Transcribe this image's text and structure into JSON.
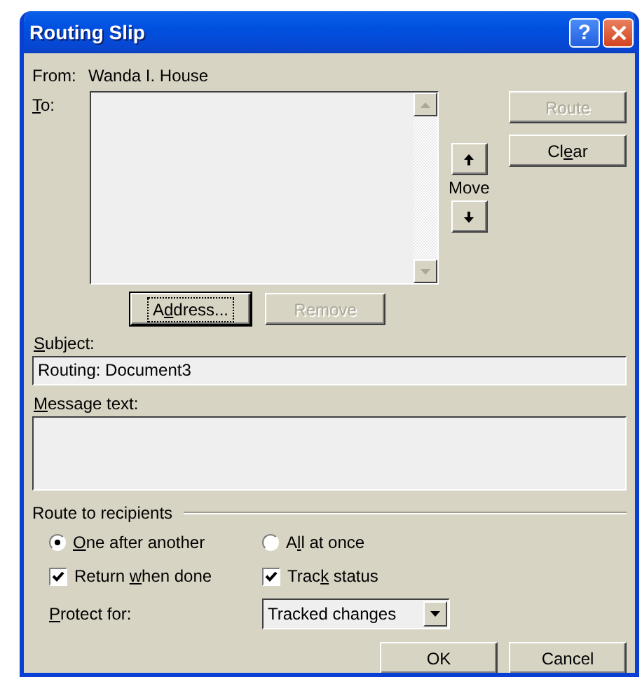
{
  "window": {
    "title": "Routing Slip",
    "help": "?"
  },
  "from": {
    "label": "From:",
    "value": "Wanda I. House"
  },
  "to": {
    "label": {
      "key": "T",
      "post": "o:"
    }
  },
  "move": {
    "label": "Move"
  },
  "side_buttons": [
    {
      "label": {
        "pre": "Route"
      },
      "disabled": true
    },
    {
      "label": {
        "pre": "Cl",
        "key": "e",
        "post": "ar"
      },
      "disabled": false
    }
  ],
  "list_buttons": [
    {
      "label": {
        "pre": "A",
        "key": "d",
        "post": "dress..."
      },
      "disabled": false,
      "default": true
    },
    {
      "label": {
        "pre": "Remove"
      },
      "disabled": true,
      "default": false
    }
  ],
  "subject": {
    "label": {
      "key": "S",
      "post": "ubject:"
    },
    "value": "Routing: Document3"
  },
  "message": {
    "label": {
      "key": "M",
      "post": "essage text:"
    }
  },
  "route_group": {
    "title": "Route to recipients",
    "options": [
      {
        "label": {
          "key": "O",
          "post": "ne after another"
        },
        "selected": true
      },
      {
        "label": {
          "pre": "A",
          "key": "l",
          "post": "l at once"
        },
        "selected": false
      }
    ],
    "checks": [
      {
        "label": {
          "pre": "Return ",
          "key": "w",
          "post": "hen done"
        },
        "checked": true
      },
      {
        "label": {
          "pre": "Trac",
          "key": "k",
          "post": " status"
        },
        "checked": true
      }
    ],
    "protect": {
      "label": {
        "key": "P",
        "post": "rotect for:"
      },
      "value": "Tracked changes"
    }
  },
  "footer_buttons": [
    {
      "label": {
        "pre": "OK"
      }
    },
    {
      "label": {
        "pre": "Cancel"
      }
    }
  ]
}
